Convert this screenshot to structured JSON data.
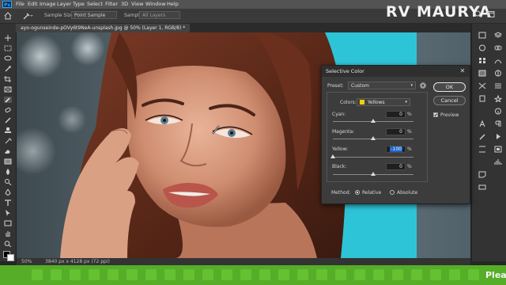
{
  "menu": {
    "app_badge": "Ps",
    "items": [
      "File",
      "Edit",
      "Image",
      "Layer",
      "Type",
      "Select",
      "Filter",
      "3D",
      "View",
      "Window",
      "Help"
    ]
  },
  "options_bar": {
    "sample_size_label": "Sample Size:",
    "sample_size_value": "Point Sample",
    "sample_label": "Sample:",
    "sample_value": "All Layers"
  },
  "brand": "RV MAURYA",
  "document_tab": "ayo-ogunseinde-pOVy6t9NeA-unsplash.jpg @ 50% (Layer 1, RGB/8) *",
  "status": {
    "zoom": "50%",
    "doc_info": "3840 px x 4128 px (72 ppi)"
  },
  "taskbar": {
    "text": "Pleas"
  },
  "dialog": {
    "title": "Selective Color",
    "preset_label": "Preset:",
    "preset_value": "Custom",
    "colors_label": "Colors:",
    "colors_value": "Yellows",
    "colors_swatch": "#f0d000",
    "ok_label": "OK",
    "cancel_label": "Cancel",
    "preview_label": "Preview",
    "preview_checked": true,
    "sliders": [
      {
        "label": "Cyan:",
        "value": "0",
        "unit": "%",
        "level": 0.5
      },
      {
        "label": "Magenta:",
        "value": "0",
        "unit": "%",
        "level": 0.5
      },
      {
        "label": "Yellow:",
        "value": "-100",
        "unit": "%",
        "level": 0.0
      },
      {
        "label": "Black:",
        "value": "0",
        "unit": "%",
        "level": 0.5
      }
    ],
    "method_label": "Method:",
    "method_options": [
      "Relative",
      "Absolute"
    ],
    "method_selected": "Relative"
  },
  "colors": {
    "taskbar": "#56ae28",
    "accent": "#31a8ff",
    "highlight_field": "#1d64c8"
  }
}
